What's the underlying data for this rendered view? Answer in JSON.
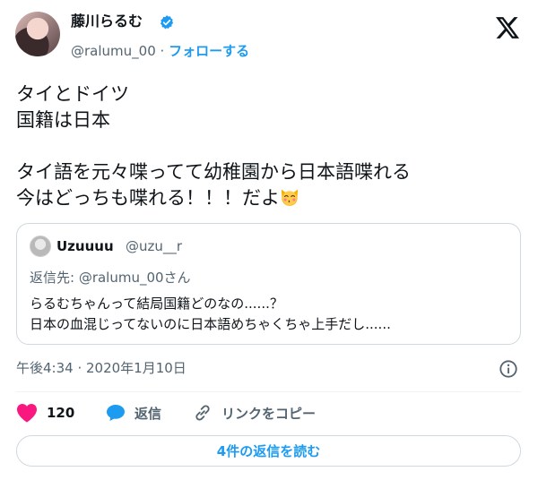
{
  "author": {
    "name": "藤川らるむ",
    "handle": "@ralumu_00",
    "separator": "·",
    "follow_label": "フォローする",
    "verified_icon": "verified-badge-icon"
  },
  "tweet": {
    "text": "タイとドイツ\n国籍は日本\n\nタイ語を元々喋ってて幼稚園から日本語喋れる\n今はどっちも喋れる！！！だよ",
    "emoji": "kissing-cat-emoji"
  },
  "quote": {
    "name": "Uzuuuu",
    "handle": "@uzu__r",
    "reply_to": "返信先: @ralumu_00さん",
    "text": "らるむちゃんって結局国籍どのなの......？\n日本の血混じってないのに日本語めちゃくちゃ上手だし......"
  },
  "timestamp": "午後4:34 · 2020年1月10日",
  "actions": {
    "like_count": "120",
    "reply_label": "返信",
    "copy_link_label": "リンクをコピー"
  },
  "read_replies_label": "4件の返信を読む",
  "colors": {
    "accent": "#1d9bf0",
    "like": "#f91880",
    "text": "#0f1419",
    "muted": "#536471"
  }
}
